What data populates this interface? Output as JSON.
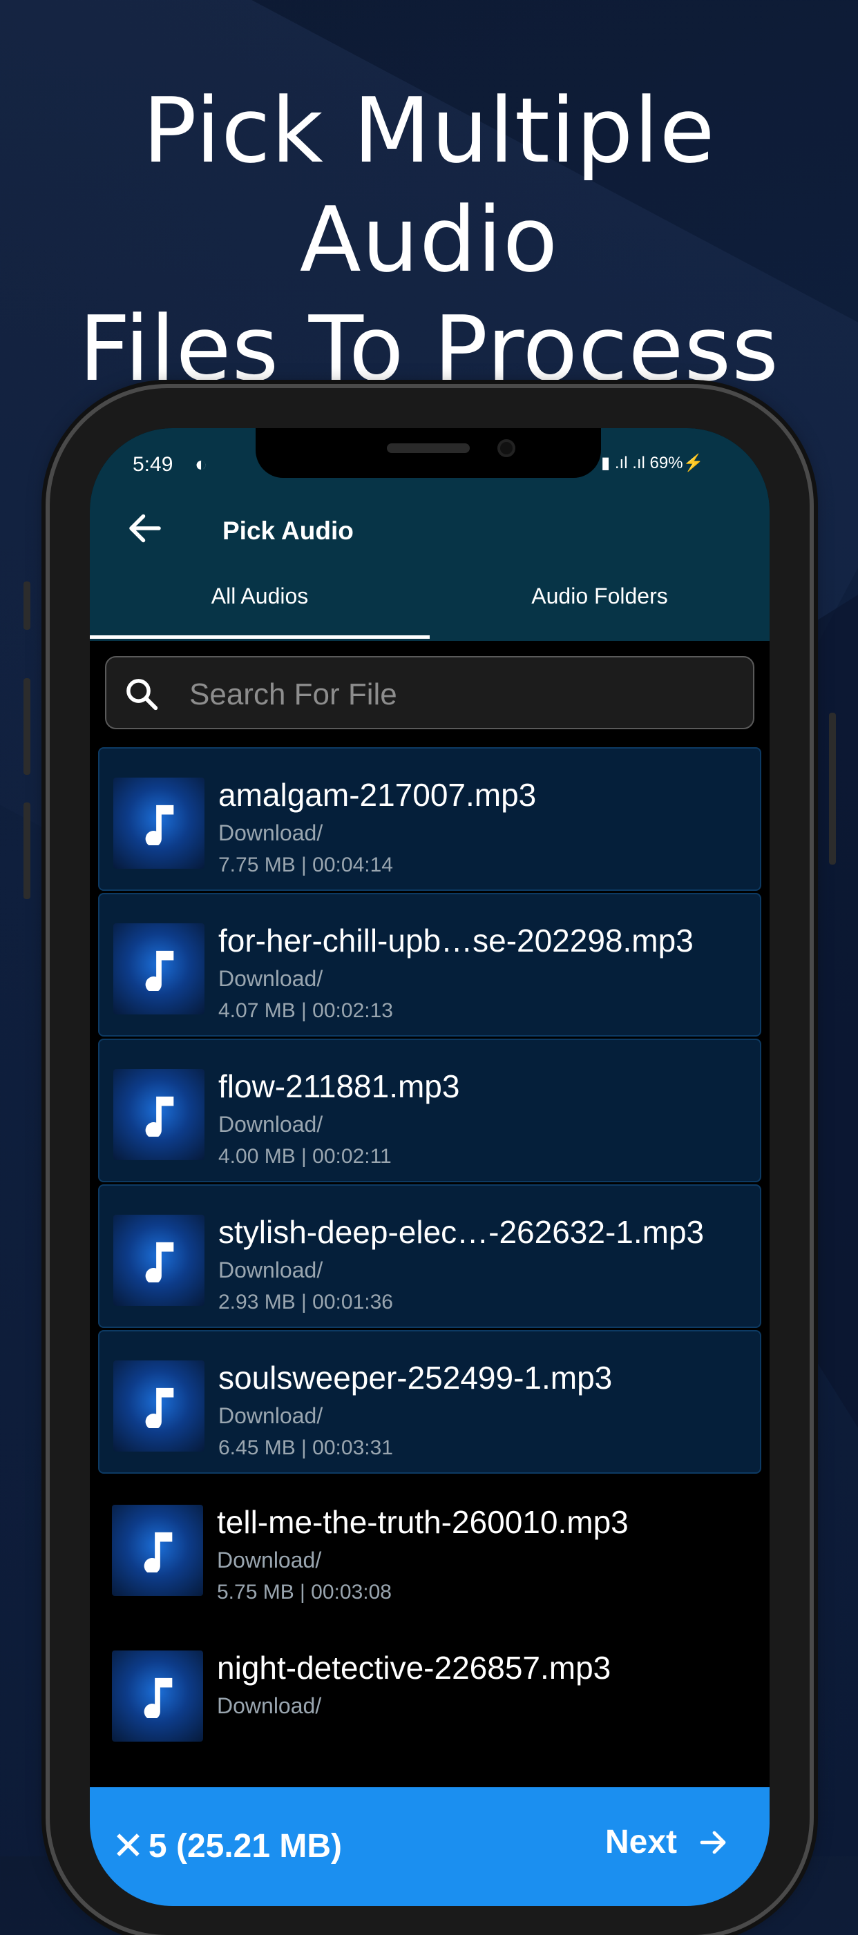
{
  "headline": {
    "line1": "Pick Multiple Audio",
    "line2": "Files To Process"
  },
  "status_bar": {
    "time": "5:49",
    "app_icon": "d-icon",
    "right": "▮ .ıl .ıl 69%⚡"
  },
  "app_bar": {
    "title": "Pick Audio",
    "back_icon": "arrow-left-icon"
  },
  "tabs": [
    {
      "label": "All Audios",
      "active": true
    },
    {
      "label": "Audio Folders",
      "active": false
    }
  ],
  "search": {
    "placeholder": "Search For File",
    "value": ""
  },
  "files": [
    {
      "name": "amalgam-217007.mp3",
      "path": "Download/",
      "meta": "7.75 MB | 00:04:14",
      "selected": true
    },
    {
      "name": "for-her-chill-upb…se-202298.mp3",
      "path": "Download/",
      "meta": "4.07 MB | 00:02:13",
      "selected": true
    },
    {
      "name": "flow-211881.mp3",
      "path": "Download/",
      "meta": "4.00 MB | 00:02:11",
      "selected": true
    },
    {
      "name": "stylish-deep-elec…-262632-1.mp3",
      "path": "Download/",
      "meta": "2.93 MB | 00:01:36",
      "selected": true
    },
    {
      "name": "soulsweeper-252499-1.mp3",
      "path": "Download/",
      "meta": "6.45 MB | 00:03:31",
      "selected": true
    },
    {
      "name": "tell-me-the-truth-260010.mp3",
      "path": "Download/",
      "meta": "5.75 MB | 00:03:08",
      "selected": false
    },
    {
      "name": "night-detective-226857.mp3",
      "path": "Download/",
      "meta": "",
      "selected": false
    }
  ],
  "bottom_bar": {
    "selection": "5 (25.21 MB)",
    "next_label": "Next",
    "color": "#1b8ff0"
  },
  "colors": {
    "app_bar": "#073447",
    "selected_row": "#051f3a",
    "accent": "#1b8ff0"
  }
}
